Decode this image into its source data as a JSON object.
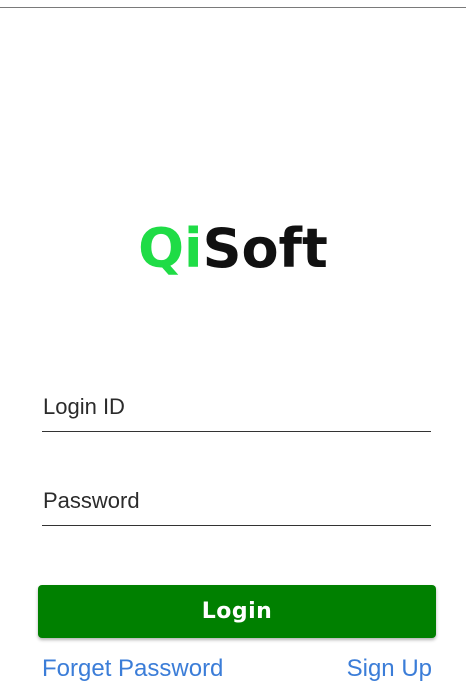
{
  "logo": {
    "part1": "Qi",
    "part2": "Soft"
  },
  "form": {
    "login_id_placeholder": "Login ID",
    "password_placeholder": "Password",
    "login_button_label": "Login"
  },
  "links": {
    "forget_password": "Forget Password",
    "sign_up": "Sign Up"
  },
  "colors": {
    "brand_green": "#1fdc46",
    "button_green": "#008000",
    "link_blue": "#3b7dd8"
  }
}
